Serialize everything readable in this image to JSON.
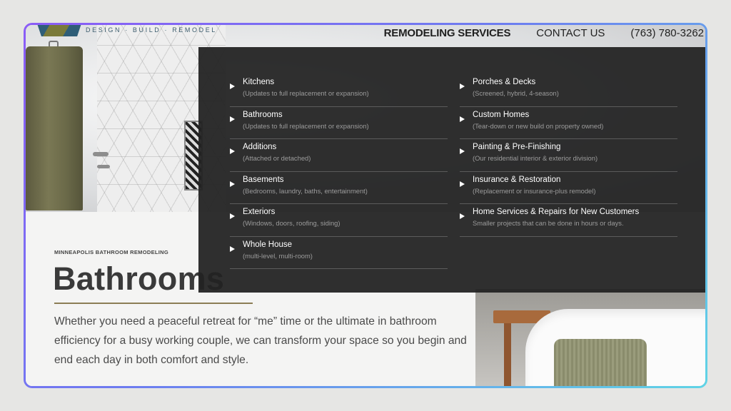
{
  "header": {
    "tagline": "DESIGN · BUILD · REMODEL",
    "nav": {
      "remodeling_services": "REMODELING SERVICES",
      "contact_us": "CONTACT US",
      "phone": "(763) 780-3262"
    }
  },
  "dropdown": {
    "left_column": [
      {
        "title": "Kitchens",
        "subtitle": "(Updates to full replacement or expansion)"
      },
      {
        "title": "Bathrooms",
        "subtitle": "(Updates to full replacement or expansion)"
      },
      {
        "title": "Additions",
        "subtitle": "(Attached or detached)"
      },
      {
        "title": "Basements",
        "subtitle": "(Bedrooms, laundry, baths, entertainment)"
      },
      {
        "title": "Exteriors",
        "subtitle": "(Windows, doors, roofing, siding)"
      },
      {
        "title": "Whole House",
        "subtitle": "(multi-level, multi-room)"
      }
    ],
    "right_column": [
      {
        "title": "Porches & Decks",
        "subtitle": "(Screened, hybrid, 4-season)"
      },
      {
        "title": "Custom Homes",
        "subtitle": "(Tear-down or new build on property owned)"
      },
      {
        "title": "Painting & Pre-Finishing",
        "subtitle": "(Our residential interior & exterior division)"
      },
      {
        "title": "Insurance & Restoration",
        "subtitle": "(Replacement or insurance-plus remodel)"
      },
      {
        "title": "Home Services & Repairs for New Customers",
        "subtitle": "Smaller projects that can be done in hours or days."
      }
    ]
  },
  "hero": {
    "eyebrow": "MINNEAPOLIS BATHROOM REMODELING",
    "title": "Bathrooms",
    "intro": "Whether you need a peaceful retreat for “me” time or the ultimate in bathroom efficiency for a busy working couple, we can transform your space so you begin and end each day in both comfort and style."
  },
  "colors": {
    "dropdown_bg": "#222222",
    "accent_rule": "#8b7d55",
    "frame_gradient_start": "#8b5cf6",
    "frame_gradient_end": "#5fd4e6"
  }
}
